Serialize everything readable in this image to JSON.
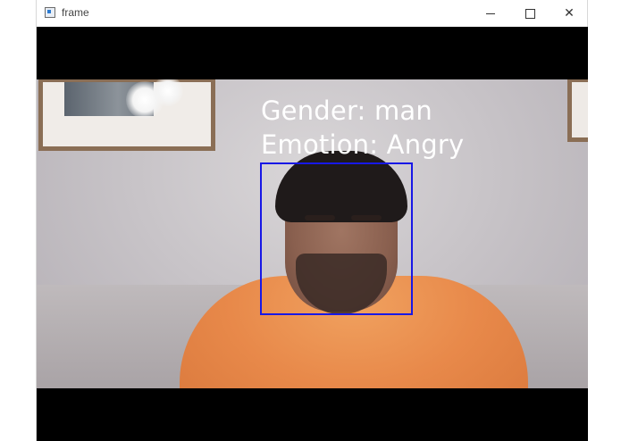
{
  "window": {
    "title": "frame",
    "controls": {
      "minimize_icon": "minimize-icon",
      "maximize_icon": "maximize-icon",
      "close_icon": "close-icon",
      "close_glyph": "✕"
    }
  },
  "overlay": {
    "gender_text": "Gender: man",
    "emotion_text": "Emotion: Angry",
    "box_color": "#1818e6",
    "text_color": "#ffffff"
  }
}
